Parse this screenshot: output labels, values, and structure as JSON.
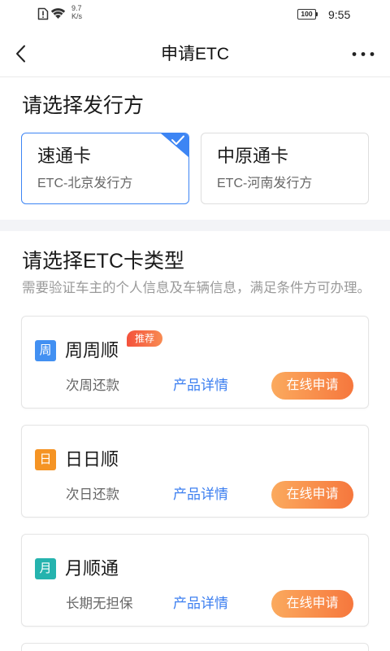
{
  "theme": {
    "accent": "#3d85f4",
    "link": "#3d7ff0",
    "apply_start": "#fbaa5e",
    "apply_end": "#f6773d",
    "badge_start": "#f4513c",
    "badge_end": "#f88b52",
    "band": "#f3f4f7"
  },
  "icons": {
    "sim": "sim-alert-icon",
    "wifi": "wifi-icon",
    "battery": "battery-icon",
    "back": "chevron-left-icon",
    "more": "more-dots-icon",
    "selected": "check-icon"
  },
  "status_bar": {
    "speed_value": "9.7",
    "speed_unit": "K/s",
    "battery": "100",
    "time": "9:55"
  },
  "header": {
    "title": "申请ETC"
  },
  "issuer_section": {
    "title": "请选择发行方",
    "options": [
      {
        "name": "速通卡",
        "desc": "ETC-北京发行方",
        "selected": true
      },
      {
        "name": "中原通卡",
        "desc": "ETC-河南发行方",
        "selected": false
      }
    ]
  },
  "card_type_section": {
    "title": "请选择ETC卡类型",
    "subtitle": "需要验证车主的个人信息及车辆信息，满足条件方可办理。",
    "products": [
      {
        "icon_char": "周",
        "icon_color": "#4290f2",
        "name": "周周顺",
        "badge": "推荐",
        "term": "次周还款",
        "detail_label": "产品详情",
        "apply_label": "在线申请"
      },
      {
        "icon_char": "日",
        "icon_color": "#f59424",
        "name": "日日顺",
        "term": "次日还款",
        "detail_label": "产品详情",
        "apply_label": "在线申请"
      },
      {
        "icon_char": "月",
        "icon_color": "#25b3ae",
        "name": "月顺通",
        "term": "长期无担保",
        "detail_label": "产品详情",
        "apply_label": "在线申请"
      }
    ]
  }
}
